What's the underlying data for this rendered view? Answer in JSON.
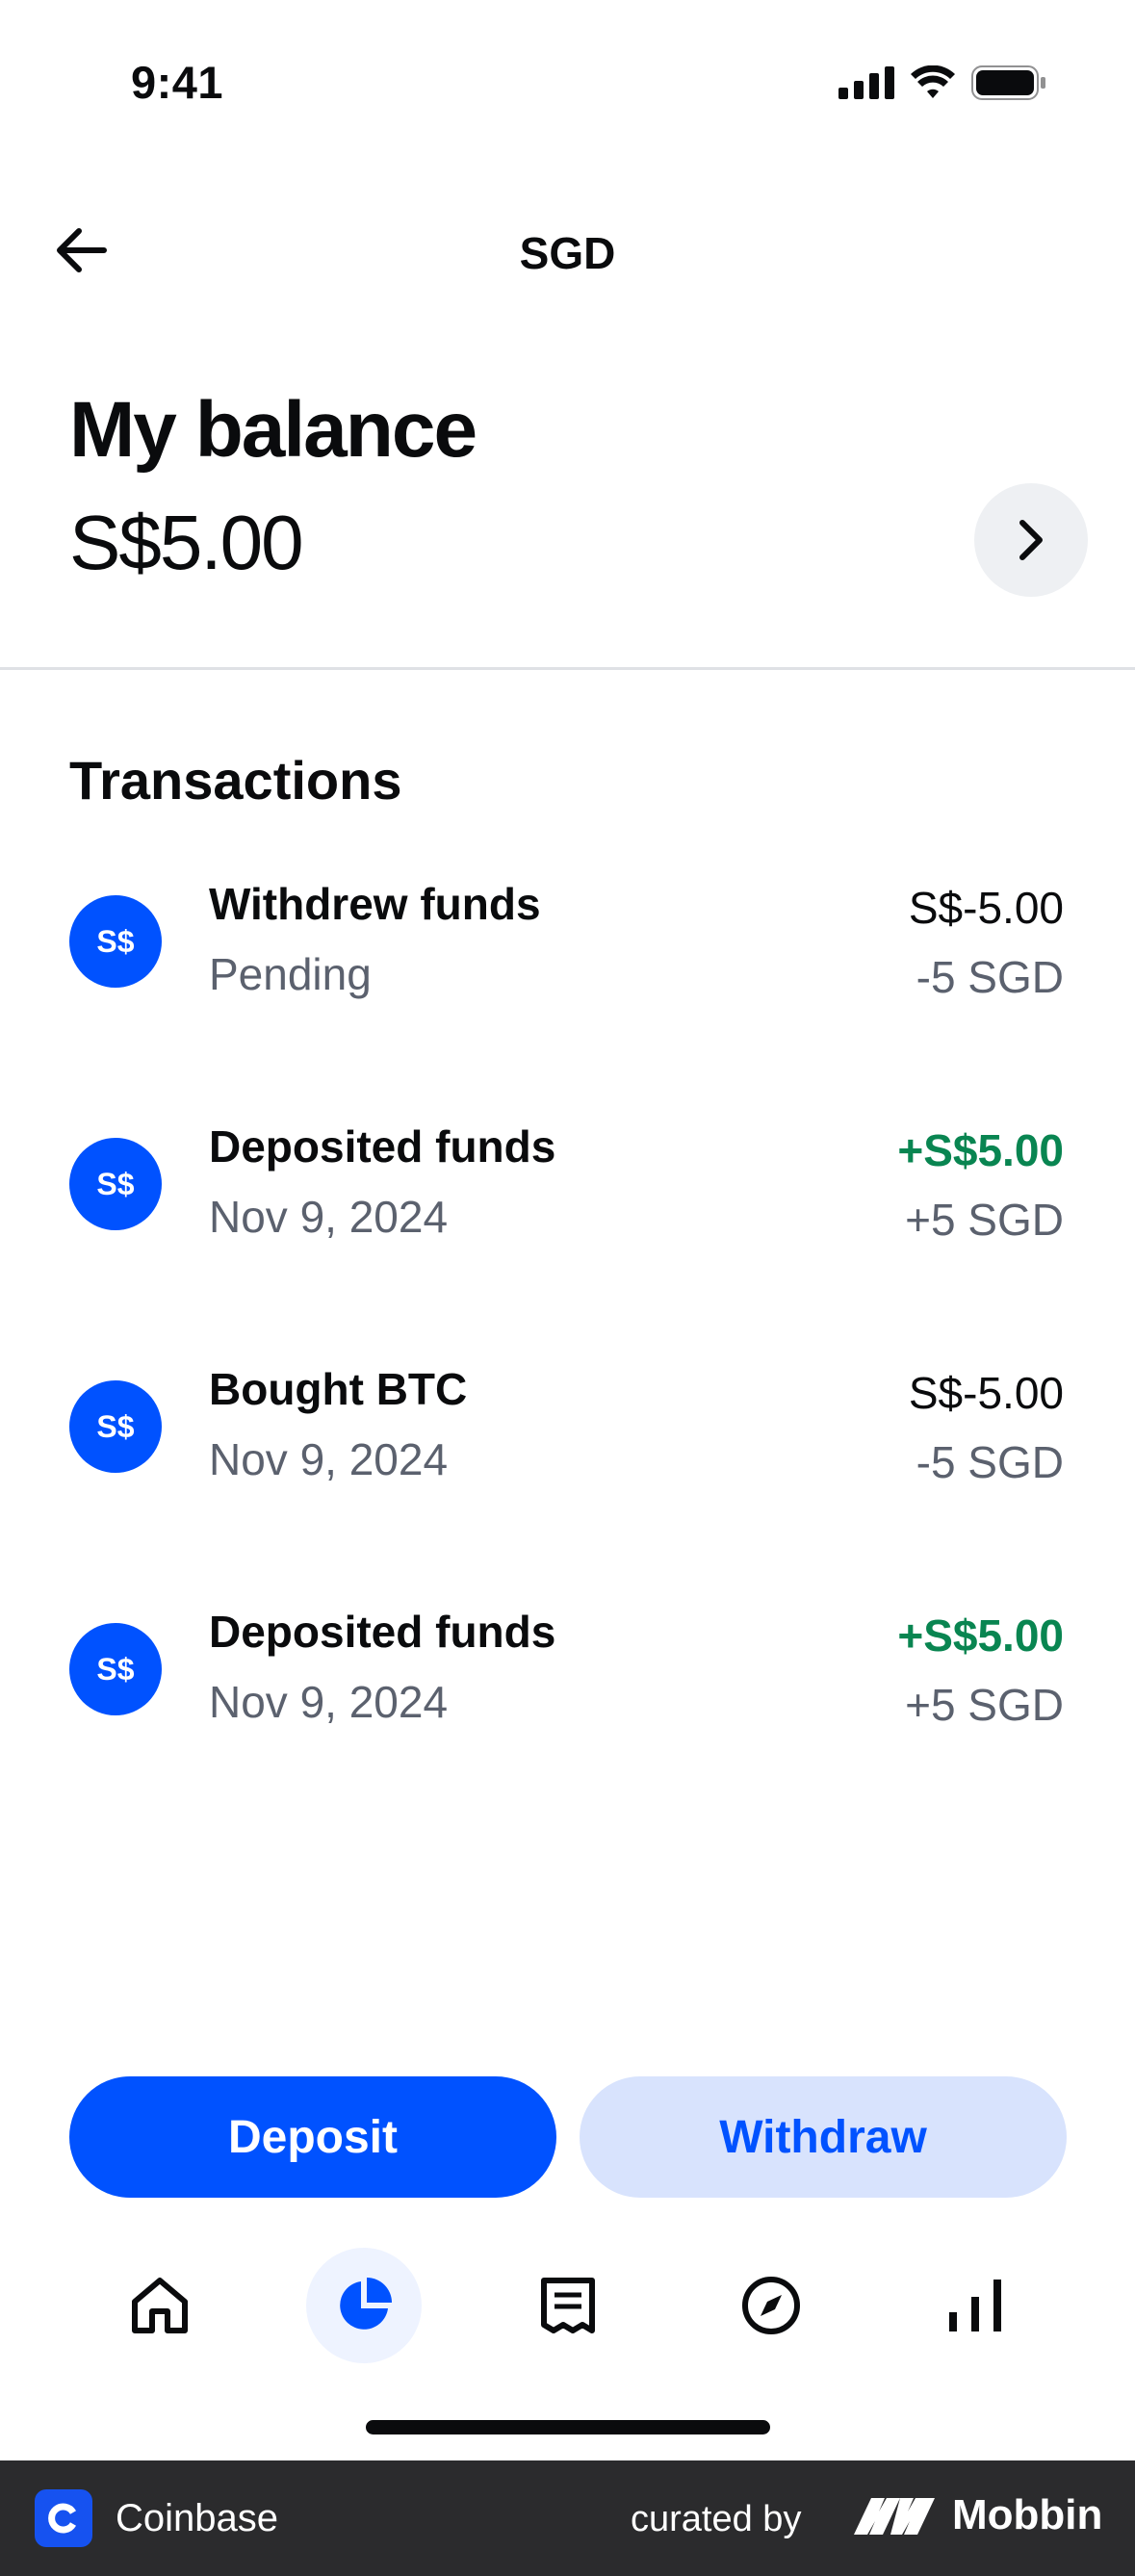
{
  "status_bar": {
    "time": "9:41"
  },
  "header": {
    "title": "SGD"
  },
  "balance": {
    "label": "My balance",
    "value": "S$5.00"
  },
  "transactions": {
    "heading": "Transactions",
    "items": [
      {
        "icon_text": "S$",
        "title": "Withdrew funds",
        "subtitle": "Pending",
        "amount": "S$-5.00",
        "native": "-5 SGD",
        "positive": false
      },
      {
        "icon_text": "S$",
        "title": "Deposited funds",
        "subtitle": "Nov 9, 2024",
        "amount": "+S$5.00",
        "native": "+5 SGD",
        "positive": true
      },
      {
        "icon_text": "S$",
        "title": "Bought BTC",
        "subtitle": "Nov 9, 2024",
        "amount": "S$-5.00",
        "native": "-5 SGD",
        "positive": false
      },
      {
        "icon_text": "S$",
        "title": "Deposited funds",
        "subtitle": "Nov 9, 2024",
        "amount": "+S$5.00",
        "native": "+5 SGD",
        "positive": true
      }
    ]
  },
  "actions": {
    "deposit_label": "Deposit",
    "withdraw_label": "Withdraw"
  },
  "bottom_nav": {
    "items": [
      {
        "icon": "home-icon",
        "active": false
      },
      {
        "icon": "portfolio-pie-icon",
        "active": true
      },
      {
        "icon": "transactions-receipt-icon",
        "active": false
      },
      {
        "icon": "explore-compass-icon",
        "active": false
      },
      {
        "icon": "trade-bars-icon",
        "active": false
      }
    ]
  },
  "footer": {
    "app_name": "Coinbase",
    "curated_by": "curated by",
    "brand": "Mobbin"
  },
  "colors": {
    "accent": "#0052ff",
    "positive": "#098551",
    "muted": "#5b616e",
    "accent_light": "#d8e3fd"
  }
}
